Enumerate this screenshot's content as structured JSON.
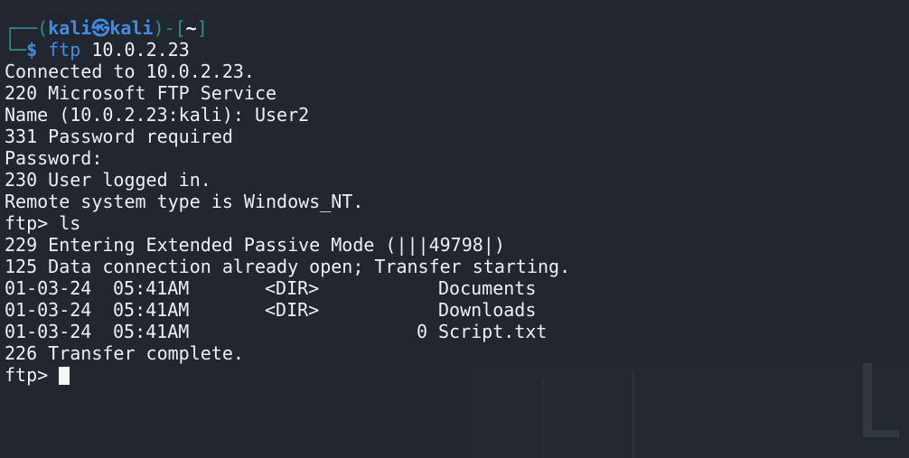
{
  "prompt": {
    "frame_top_left": "┌──(",
    "user": "kali",
    "skull": "㉿",
    "host": "kali",
    "sep": ")-[",
    "cwd": "~",
    "close": "]",
    "frame_bottom_left": "└─",
    "dollar": "$"
  },
  "command": {
    "name": "ftp",
    "arg": "10.0.2.23"
  },
  "output": [
    "Connected to 10.0.2.23.",
    "220 Microsoft FTP Service",
    "Name (10.0.2.23:kali): User2",
    "331 Password required",
    "Password: ",
    "230 User logged in.",
    "Remote system type is Windows_NT.",
    "ftp> ls",
    "229 Entering Extended Passive Mode (|||49798|)",
    "125 Data connection already open; Transfer starting."
  ],
  "listing": [
    {
      "date": "01-03-24",
      "time": "05:41AM",
      "dir": "<DIR>",
      "size": "",
      "name": "Documents"
    },
    {
      "date": "01-03-24",
      "time": "05:41AM",
      "dir": "<DIR>",
      "size": "",
      "name": "Downloads"
    },
    {
      "date": "01-03-24",
      "time": "05:41AM",
      "dir": "",
      "size": "0",
      "name": "Script.txt"
    }
  ],
  "after": [
    "226 Transfer complete."
  ],
  "final_prompt": "ftp> "
}
